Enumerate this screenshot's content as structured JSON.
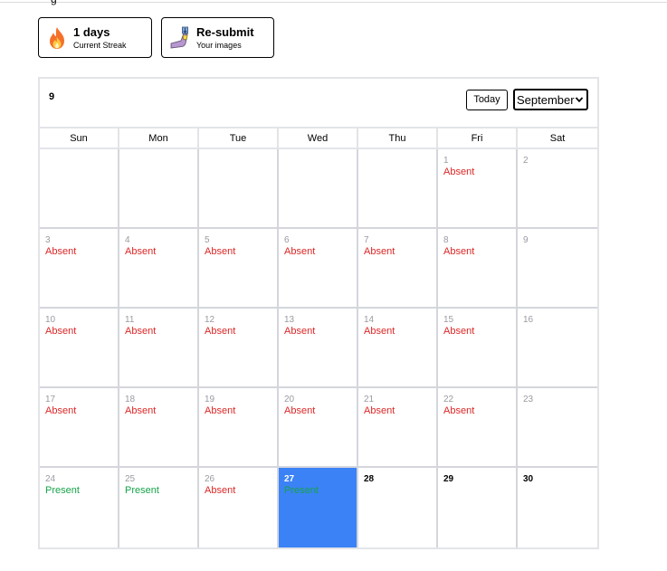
{
  "header_fragment": "g",
  "cards": {
    "streak": {
      "icon": "fire-icon",
      "title": "1 days",
      "subtitle": "Current Streak"
    },
    "resubmit": {
      "icon": "upload-arm-icon",
      "title": "Re-submit",
      "subtitle": "Your images"
    }
  },
  "calendar": {
    "month_number": "9",
    "today_label": "Today",
    "selected_month": "September",
    "weekdays": [
      "Sun",
      "Mon",
      "Tue",
      "Wed",
      "Thu",
      "Fri",
      "Sat"
    ],
    "leading_blanks": 5,
    "today_day": 27,
    "colors": {
      "absent": "#dc2626",
      "present": "#16a34a",
      "today_bg": "#3b82f6"
    },
    "days": [
      {
        "day": "1",
        "status": "Absent"
      },
      {
        "day": "2",
        "status": ""
      },
      {
        "day": "3",
        "status": "Absent"
      },
      {
        "day": "4",
        "status": "Absent"
      },
      {
        "day": "5",
        "status": "Absent"
      },
      {
        "day": "6",
        "status": "Absent"
      },
      {
        "day": "7",
        "status": "Absent"
      },
      {
        "day": "8",
        "status": "Absent"
      },
      {
        "day": "9",
        "status": ""
      },
      {
        "day": "10",
        "status": "Absent"
      },
      {
        "day": "11",
        "status": "Absent"
      },
      {
        "day": "12",
        "status": "Absent"
      },
      {
        "day": "13",
        "status": "Absent"
      },
      {
        "day": "14",
        "status": "Absent"
      },
      {
        "day": "15",
        "status": "Absent"
      },
      {
        "day": "16",
        "status": ""
      },
      {
        "day": "17",
        "status": "Absent"
      },
      {
        "day": "18",
        "status": "Absent"
      },
      {
        "day": "19",
        "status": "Absent"
      },
      {
        "day": "20",
        "status": "Absent"
      },
      {
        "day": "21",
        "status": "Absent"
      },
      {
        "day": "22",
        "status": "Absent"
      },
      {
        "day": "23",
        "status": ""
      },
      {
        "day": "24",
        "status": "Present"
      },
      {
        "day": "25",
        "status": "Present"
      },
      {
        "day": "26",
        "status": "Absent"
      },
      {
        "day": "27",
        "status": "Present"
      },
      {
        "day": "28",
        "status": ""
      },
      {
        "day": "29",
        "status": ""
      },
      {
        "day": "30",
        "status": ""
      }
    ]
  }
}
